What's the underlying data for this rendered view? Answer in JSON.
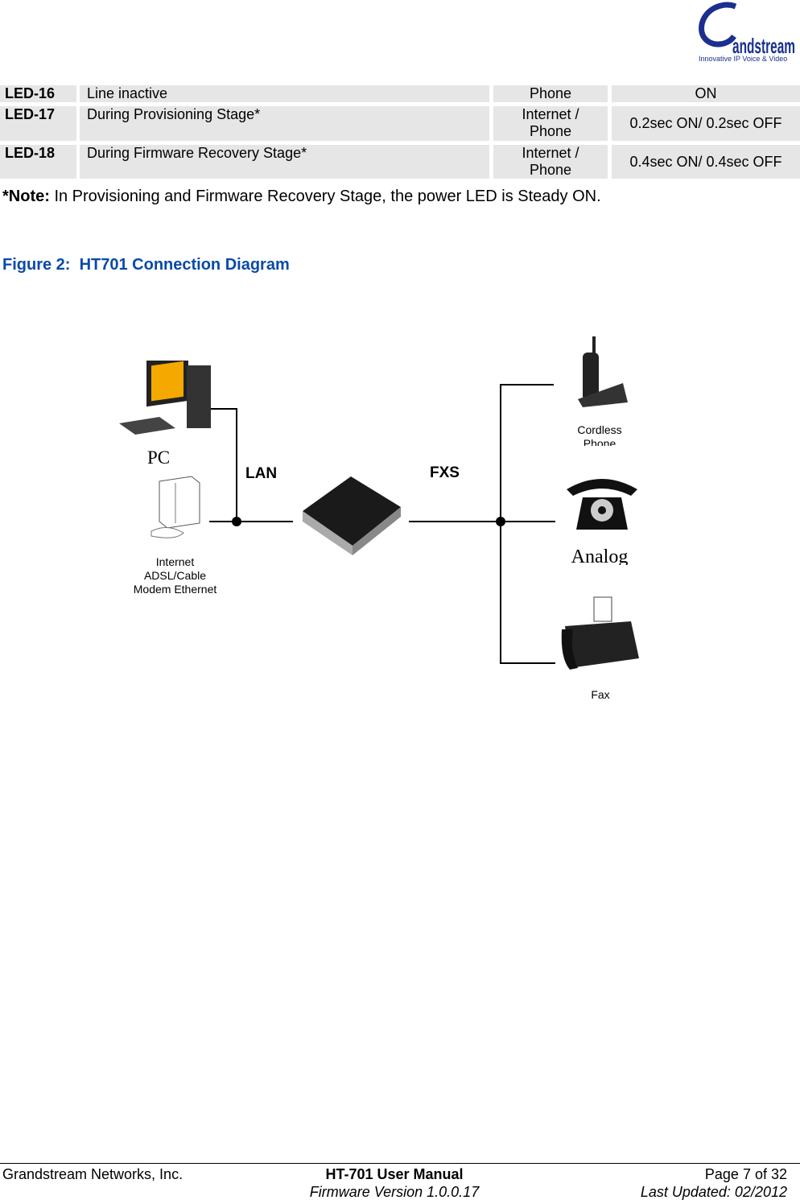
{
  "header": {
    "logo_text": "Grandstream",
    "logo_tagline": "Innovative IP Voice & Video",
    "brand_color": "#1a2f8f"
  },
  "led_table": {
    "rows": [
      {
        "id": "LED-16",
        "description": "Line inactive",
        "led": "Phone",
        "status": "ON"
      },
      {
        "id": "LED-17",
        "description": "During Provisioning Stage*",
        "led": "Internet / Phone",
        "status": "0.2sec ON/ 0.2sec OFF"
      },
      {
        "id": "LED-18",
        "description": "During Firmware Recovery Stage*",
        "led": "Internet / Phone",
        "status": "0.4sec ON/ 0.4sec OFF"
      }
    ]
  },
  "note": {
    "label": "*Note:",
    "text": " In Provisioning and Firmware Recovery Stage, the power LED is Steady ON."
  },
  "figure": {
    "caption": "Figure 2:  HT701 Connection Diagram",
    "caption_color": "#0a4aa8",
    "labels": {
      "pc": "PC",
      "lan": "LAN",
      "fxs": "FXS",
      "cordless_phone": "Cordless Phone",
      "analog": "Analog",
      "fax": "Fax",
      "modem_line1": "Internet",
      "modem_line2": "ADSL/Cable",
      "modem_line3": "Modem Ethernet"
    }
  },
  "footer": {
    "company": "Grandstream Networks, Inc.",
    "title": "HT-701 User Manual",
    "firmware": "Firmware Version 1.0.0.17",
    "page": "Page 7 of 32",
    "updated": "Last Updated: 02/2012"
  }
}
